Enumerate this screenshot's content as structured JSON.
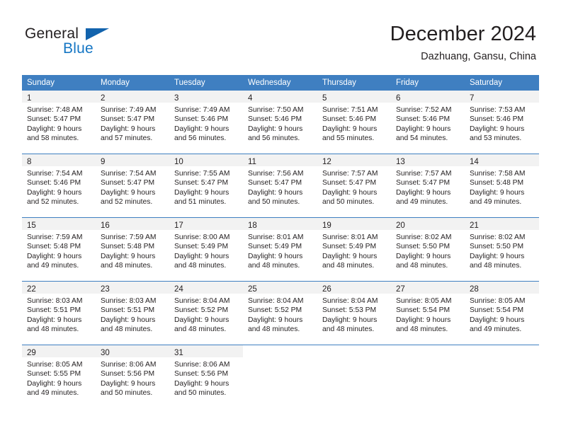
{
  "brand": {
    "name_part1": "General",
    "name_part2": "Blue",
    "color_dark": "#231f20",
    "color_blue": "#1576c4"
  },
  "header": {
    "month_title": "December 2024",
    "location": "Dazhuang, Gansu, China"
  },
  "calendar": {
    "header_bg": "#3f7fc1",
    "header_text_color": "#ffffff",
    "daynum_band_bg": "#f2f2f2",
    "weekday_headers": [
      "Sunday",
      "Monday",
      "Tuesday",
      "Wednesday",
      "Thursday",
      "Friday",
      "Saturday"
    ],
    "weeks": [
      [
        {
          "day": "1",
          "sunrise": "Sunrise: 7:48 AM",
          "sunset": "Sunset: 5:47 PM",
          "daylight_line1": "Daylight: 9 hours",
          "daylight_line2": "and 58 minutes."
        },
        {
          "day": "2",
          "sunrise": "Sunrise: 7:49 AM",
          "sunset": "Sunset: 5:47 PM",
          "daylight_line1": "Daylight: 9 hours",
          "daylight_line2": "and 57 minutes."
        },
        {
          "day": "3",
          "sunrise": "Sunrise: 7:49 AM",
          "sunset": "Sunset: 5:46 PM",
          "daylight_line1": "Daylight: 9 hours",
          "daylight_line2": "and 56 minutes."
        },
        {
          "day": "4",
          "sunrise": "Sunrise: 7:50 AM",
          "sunset": "Sunset: 5:46 PM",
          "daylight_line1": "Daylight: 9 hours",
          "daylight_line2": "and 56 minutes."
        },
        {
          "day": "5",
          "sunrise": "Sunrise: 7:51 AM",
          "sunset": "Sunset: 5:46 PM",
          "daylight_line1": "Daylight: 9 hours",
          "daylight_line2": "and 55 minutes."
        },
        {
          "day": "6",
          "sunrise": "Sunrise: 7:52 AM",
          "sunset": "Sunset: 5:46 PM",
          "daylight_line1": "Daylight: 9 hours",
          "daylight_line2": "and 54 minutes."
        },
        {
          "day": "7",
          "sunrise": "Sunrise: 7:53 AM",
          "sunset": "Sunset: 5:46 PM",
          "daylight_line1": "Daylight: 9 hours",
          "daylight_line2": "and 53 minutes."
        }
      ],
      [
        {
          "day": "8",
          "sunrise": "Sunrise: 7:54 AM",
          "sunset": "Sunset: 5:46 PM",
          "daylight_line1": "Daylight: 9 hours",
          "daylight_line2": "and 52 minutes."
        },
        {
          "day": "9",
          "sunrise": "Sunrise: 7:54 AM",
          "sunset": "Sunset: 5:47 PM",
          "daylight_line1": "Daylight: 9 hours",
          "daylight_line2": "and 52 minutes."
        },
        {
          "day": "10",
          "sunrise": "Sunrise: 7:55 AM",
          "sunset": "Sunset: 5:47 PM",
          "daylight_line1": "Daylight: 9 hours",
          "daylight_line2": "and 51 minutes."
        },
        {
          "day": "11",
          "sunrise": "Sunrise: 7:56 AM",
          "sunset": "Sunset: 5:47 PM",
          "daylight_line1": "Daylight: 9 hours",
          "daylight_line2": "and 50 minutes."
        },
        {
          "day": "12",
          "sunrise": "Sunrise: 7:57 AM",
          "sunset": "Sunset: 5:47 PM",
          "daylight_line1": "Daylight: 9 hours",
          "daylight_line2": "and 50 minutes."
        },
        {
          "day": "13",
          "sunrise": "Sunrise: 7:57 AM",
          "sunset": "Sunset: 5:47 PM",
          "daylight_line1": "Daylight: 9 hours",
          "daylight_line2": "and 49 minutes."
        },
        {
          "day": "14",
          "sunrise": "Sunrise: 7:58 AM",
          "sunset": "Sunset: 5:48 PM",
          "daylight_line1": "Daylight: 9 hours",
          "daylight_line2": "and 49 minutes."
        }
      ],
      [
        {
          "day": "15",
          "sunrise": "Sunrise: 7:59 AM",
          "sunset": "Sunset: 5:48 PM",
          "daylight_line1": "Daylight: 9 hours",
          "daylight_line2": "and 49 minutes."
        },
        {
          "day": "16",
          "sunrise": "Sunrise: 7:59 AM",
          "sunset": "Sunset: 5:48 PM",
          "daylight_line1": "Daylight: 9 hours",
          "daylight_line2": "and 48 minutes."
        },
        {
          "day": "17",
          "sunrise": "Sunrise: 8:00 AM",
          "sunset": "Sunset: 5:49 PM",
          "daylight_line1": "Daylight: 9 hours",
          "daylight_line2": "and 48 minutes."
        },
        {
          "day": "18",
          "sunrise": "Sunrise: 8:01 AM",
          "sunset": "Sunset: 5:49 PM",
          "daylight_line1": "Daylight: 9 hours",
          "daylight_line2": "and 48 minutes."
        },
        {
          "day": "19",
          "sunrise": "Sunrise: 8:01 AM",
          "sunset": "Sunset: 5:49 PM",
          "daylight_line1": "Daylight: 9 hours",
          "daylight_line2": "and 48 minutes."
        },
        {
          "day": "20",
          "sunrise": "Sunrise: 8:02 AM",
          "sunset": "Sunset: 5:50 PM",
          "daylight_line1": "Daylight: 9 hours",
          "daylight_line2": "and 48 minutes."
        },
        {
          "day": "21",
          "sunrise": "Sunrise: 8:02 AM",
          "sunset": "Sunset: 5:50 PM",
          "daylight_line1": "Daylight: 9 hours",
          "daylight_line2": "and 48 minutes."
        }
      ],
      [
        {
          "day": "22",
          "sunrise": "Sunrise: 8:03 AM",
          "sunset": "Sunset: 5:51 PM",
          "daylight_line1": "Daylight: 9 hours",
          "daylight_line2": "and 48 minutes."
        },
        {
          "day": "23",
          "sunrise": "Sunrise: 8:03 AM",
          "sunset": "Sunset: 5:51 PM",
          "daylight_line1": "Daylight: 9 hours",
          "daylight_line2": "and 48 minutes."
        },
        {
          "day": "24",
          "sunrise": "Sunrise: 8:04 AM",
          "sunset": "Sunset: 5:52 PM",
          "daylight_line1": "Daylight: 9 hours",
          "daylight_line2": "and 48 minutes."
        },
        {
          "day": "25",
          "sunrise": "Sunrise: 8:04 AM",
          "sunset": "Sunset: 5:52 PM",
          "daylight_line1": "Daylight: 9 hours",
          "daylight_line2": "and 48 minutes."
        },
        {
          "day": "26",
          "sunrise": "Sunrise: 8:04 AM",
          "sunset": "Sunset: 5:53 PM",
          "daylight_line1": "Daylight: 9 hours",
          "daylight_line2": "and 48 minutes."
        },
        {
          "day": "27",
          "sunrise": "Sunrise: 8:05 AM",
          "sunset": "Sunset: 5:54 PM",
          "daylight_line1": "Daylight: 9 hours",
          "daylight_line2": "and 48 minutes."
        },
        {
          "day": "28",
          "sunrise": "Sunrise: 8:05 AM",
          "sunset": "Sunset: 5:54 PM",
          "daylight_line1": "Daylight: 9 hours",
          "daylight_line2": "and 49 minutes."
        }
      ],
      [
        {
          "day": "29",
          "sunrise": "Sunrise: 8:05 AM",
          "sunset": "Sunset: 5:55 PM",
          "daylight_line1": "Daylight: 9 hours",
          "daylight_line2": "and 49 minutes."
        },
        {
          "day": "30",
          "sunrise": "Sunrise: 8:06 AM",
          "sunset": "Sunset: 5:56 PM",
          "daylight_line1": "Daylight: 9 hours",
          "daylight_line2": "and 50 minutes."
        },
        {
          "day": "31",
          "sunrise": "Sunrise: 8:06 AM",
          "sunset": "Sunset: 5:56 PM",
          "daylight_line1": "Daylight: 9 hours",
          "daylight_line2": "and 50 minutes."
        },
        {
          "day": "",
          "sunrise": "",
          "sunset": "",
          "daylight_line1": "",
          "daylight_line2": ""
        },
        {
          "day": "",
          "sunrise": "",
          "sunset": "",
          "daylight_line1": "",
          "daylight_line2": ""
        },
        {
          "day": "",
          "sunrise": "",
          "sunset": "",
          "daylight_line1": "",
          "daylight_line2": ""
        },
        {
          "day": "",
          "sunrise": "",
          "sunset": "",
          "daylight_line1": "",
          "daylight_line2": ""
        }
      ]
    ]
  }
}
